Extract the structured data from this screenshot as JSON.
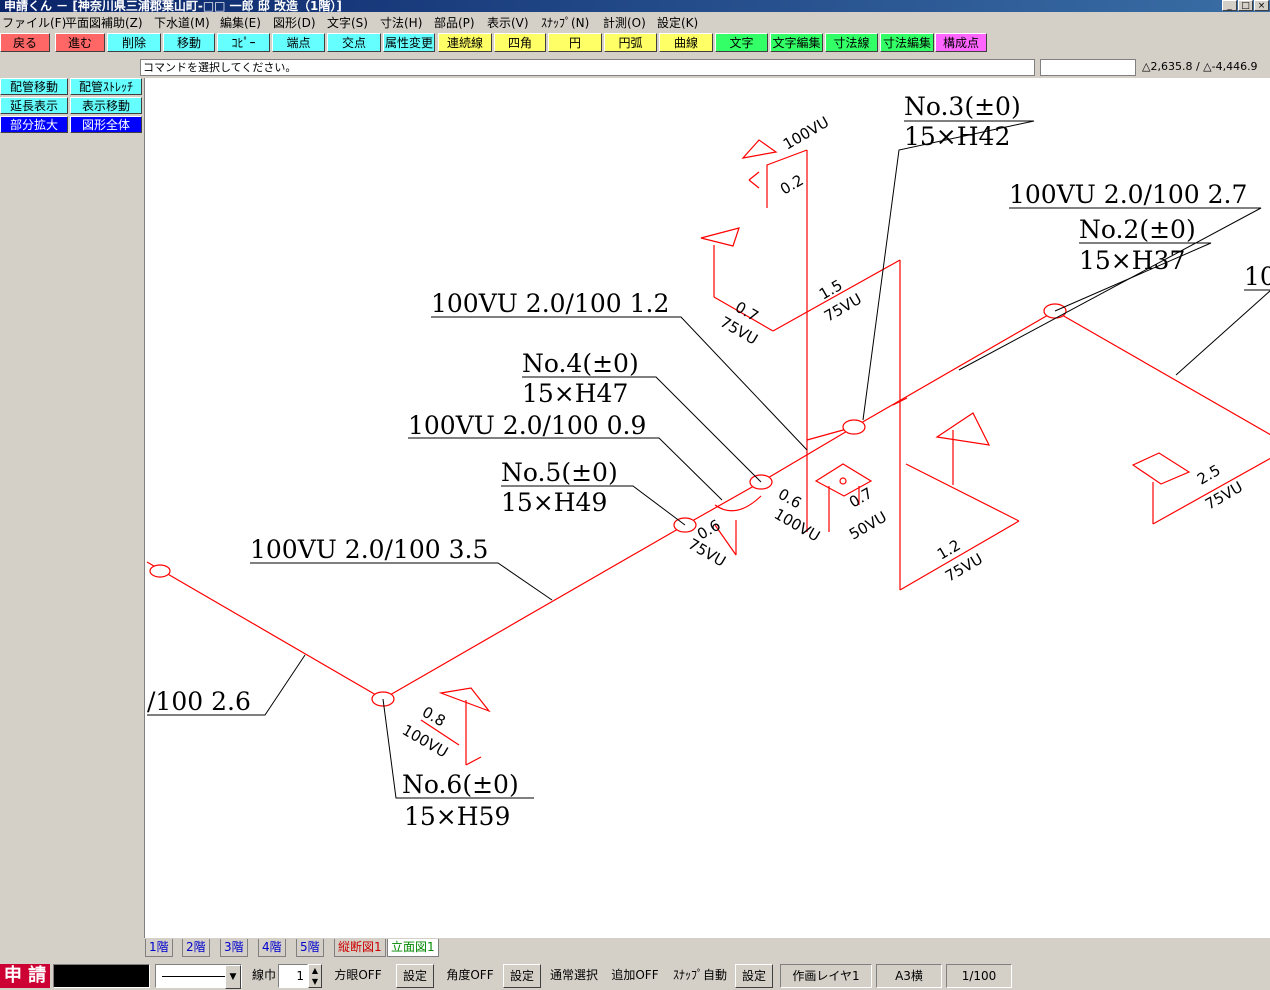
{
  "window": {
    "title": "申請くん － [神奈川県三浦郡葉山町-□□ 一郎 邸 改造（1階）]",
    "controls": [
      "_",
      "□",
      "×"
    ]
  },
  "menu": [
    "ファイル(F)",
    "平面図補助(Z)",
    "下水道(M)",
    "編集(E)",
    "図形(D)",
    "文字(S)",
    "寸法(H)",
    "部品(P)",
    "表示(V)",
    "ｽﾅｯﾌﾟ(N)",
    "計測(O)",
    "設定(K)"
  ],
  "toolbar": [
    {
      "label": "戻る",
      "color": "#ff6666"
    },
    {
      "label": "進む",
      "color": "#ff6666"
    },
    {
      "label": "削除",
      "color": "#66ffff"
    },
    {
      "label": "移動",
      "color": "#66ffff"
    },
    {
      "label": "ｺﾋﾟｰ",
      "color": "#66ffff"
    },
    {
      "label": "端点",
      "color": "#66ffff"
    },
    {
      "label": "交点",
      "color": "#66ffff"
    },
    {
      "label": "属性変更",
      "color": "#66ffff"
    },
    {
      "label": "連続線",
      "color": "#ffff66"
    },
    {
      "label": "四角",
      "color": "#ffff66"
    },
    {
      "label": "円",
      "color": "#ffff66"
    },
    {
      "label": "円弧",
      "color": "#ffff66"
    },
    {
      "label": "曲線",
      "color": "#ffff66"
    },
    {
      "label": "文字",
      "color": "#33ff66"
    },
    {
      "label": "文字編集",
      "color": "#33ff66"
    },
    {
      "label": "寸法線",
      "color": "#33ff66"
    },
    {
      "label": "寸法編集",
      "color": "#33ff66"
    },
    {
      "label": "構成点",
      "color": "#ff66ff"
    }
  ],
  "message": "コマンドを選択してください。",
  "coords": "△2,635.8 / △-4,446.9",
  "left_panel": [
    {
      "label": "配管移動",
      "color": "#66ffff",
      "text": "#000000"
    },
    {
      "label": "配管ｽﾄﾚｯﾁ",
      "color": "#66ffff",
      "text": "#000000"
    },
    {
      "label": "延長表示",
      "color": "#66ffff",
      "text": "#000000"
    },
    {
      "label": "表示移動",
      "color": "#66ffff",
      "text": "#000000"
    },
    {
      "label": "部分拡大",
      "color": "#0000ff",
      "text": "#ffffff"
    },
    {
      "label": "図形全体",
      "color": "#0000ff",
      "text": "#ffffff"
    }
  ],
  "drawing": {
    "pipe_labels": {
      "top_right": "100VU 2.0/100 2.7",
      "mid_left": "100VU 2.0/100 1.2",
      "mid": "100VU 2.0/100 0.9",
      "lower": "100VU 2.0/100 3.5",
      "left_partial": "/100 2.6",
      "far_right_partial": "10"
    },
    "manholes": {
      "no3": {
        "name": "No.3(±0)",
        "size": "15×H42"
      },
      "no2": {
        "name": "No.2(±0)",
        "size": "15×H37"
      },
      "no4": {
        "name": "No.4(±0)",
        "size": "15×H47"
      },
      "no5": {
        "name": "No.5(±0)",
        "size": "15×H49"
      },
      "no6": {
        "name": "No.6(±0)",
        "size": "15×H59"
      }
    },
    "branch_labels": {
      "b_100vu_top": "100VU",
      "b_02": "0.2",
      "b_07a": "0.7",
      "b_75vu_a": "75VU",
      "b_15": "1.5",
      "b_75vu_b": "75VU",
      "b_06a": "0.6",
      "b_100vu_a": "100VU",
      "b_07b": "0.7",
      "b_50vu": "50VU",
      "b_06b": "0.6",
      "b_75vu_c": "75VU",
      "b_12": "1.2",
      "b_75vu_d": "75VU",
      "b_25": "2.5",
      "b_75vu_e": "75VU",
      "b_08": "0.8",
      "b_100vu_b": "100VU"
    }
  },
  "floor_tabs": [
    {
      "label": "1階",
      "color": "#0000cc"
    },
    {
      "label": "2階",
      "color": "#0000cc"
    },
    {
      "label": "3階",
      "color": "#0000cc"
    },
    {
      "label": "4階",
      "color": "#0000cc"
    },
    {
      "label": "5階",
      "color": "#0000cc"
    },
    {
      "label": "縦断図1",
      "color": "#cc0000"
    },
    {
      "label": "立面図1",
      "color": "#008800"
    }
  ],
  "status": {
    "app_badge": "申 請",
    "line_width_label": "線巾",
    "line_width_value": "1",
    "grid": "方眼OFF",
    "set1": "設定",
    "angle": "角度OFF",
    "set2": "設定",
    "select_mode": "通常選択",
    "append": "追加OFF",
    "snap": "ｽﾅｯﾌﾟ自動",
    "set3": "設定",
    "layer": "作画レイヤ1",
    "paper": "A3横",
    "scale": "1/100"
  },
  "colors": {
    "pipe": "#ff0000",
    "canvas": "#ffffff",
    "chrome": "#d4d0c8"
  }
}
